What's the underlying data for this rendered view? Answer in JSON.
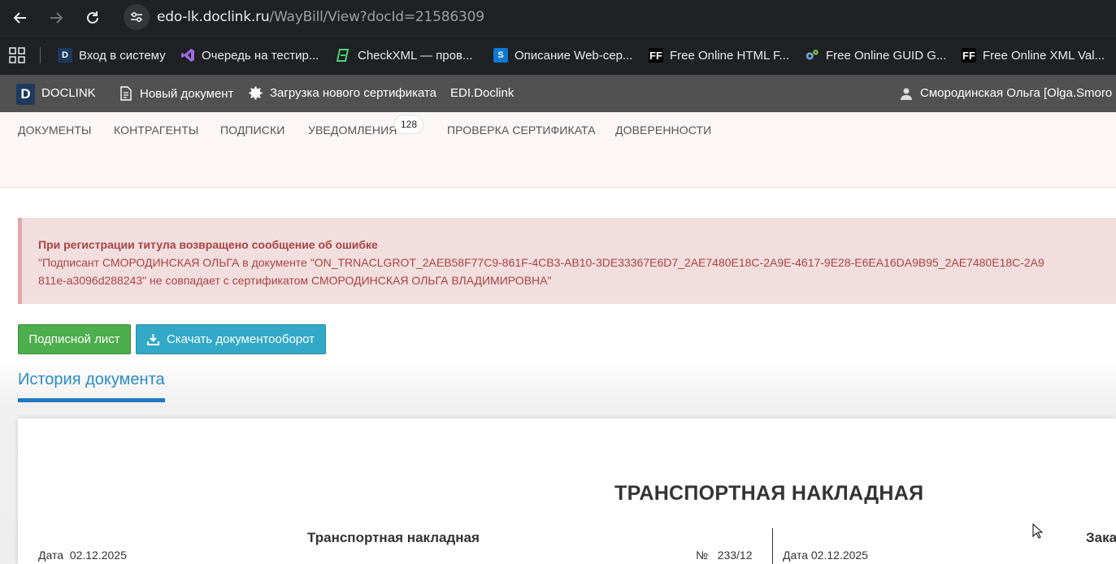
{
  "browser": {
    "url_host": "edo-lk.doclink.ru",
    "url_path": "/WayBill/View?docId=21586309",
    "bookmarks": [
      {
        "label": "Вход в систему",
        "icon": "doclink-d-icon"
      },
      {
        "label": "Очередь на тестир...",
        "icon": "visual-studio-icon"
      },
      {
        "label": "CheckXML — пров...",
        "icon": "checkxml-icon"
      },
      {
        "label": "Описание Web-сер...",
        "icon": "sharepoint-icon"
      },
      {
        "label": "Free Online HTML F...",
        "icon": "ff-icon"
      },
      {
        "label": "Free Online GUID G...",
        "icon": "gears-icon"
      },
      {
        "label": "Free Online XML Val...",
        "icon": "ff-icon"
      }
    ]
  },
  "topbar": {
    "logo_letter": "D",
    "brand": "DOCLINK",
    "new_document": "Новый документ",
    "upload_certificate": "Загрузка нового сертификата",
    "edi": "EDI.Doclink",
    "user": "Смородинская Ольга [Olga.Smoro"
  },
  "menu": {
    "items": [
      "ДОКУМЕНТЫ",
      "КОНТРАГЕНТЫ",
      "ПОДПИСКИ",
      "УВЕДОМЛЕНИЯ",
      "ПРОВЕРКА СЕРТИФИКАТА",
      "ДОВЕРЕННОСТИ"
    ],
    "notifications_count": "128"
  },
  "alert": {
    "title": "При регистрации титула возвращено сообщение об ошибке",
    "line1": "\"Подписант СМОРОДИНСКАЯ ОЛЬГА в документе \"ON_TRNACLGROT_2AEB58F77C9-861F-4CB3-AB10-3DE33367E6D7_2AE7480E18C-2A9E-4617-9E28-E6EA16DA9B95_2AE7480E18C-2A9",
    "line2": "811e-a3096d288243\" не совпадает с сертификатом СМОРОДИНСКАЯ ОЛЬГА ВЛАДИМИРОВНА\""
  },
  "buttons": {
    "signature_sheet": "Подписной лист",
    "download": "Скачать документооборот"
  },
  "history_tab": "История документа",
  "document": {
    "title": "ТРАНСПОРТНАЯ НАКЛАДНАЯ",
    "subtitle": "Транспортная накладная",
    "subtitle_right": "Зака",
    "date_left": "Дата  02.12.2025",
    "number": "№   233/12",
    "date_right": "Дата 02.12.2025"
  },
  "colors": {
    "success": "#4cae4c",
    "info": "#31a9c7",
    "link": "#2a8bc6",
    "alert_text": "#a94442",
    "alert_bg": "#f2dede"
  }
}
